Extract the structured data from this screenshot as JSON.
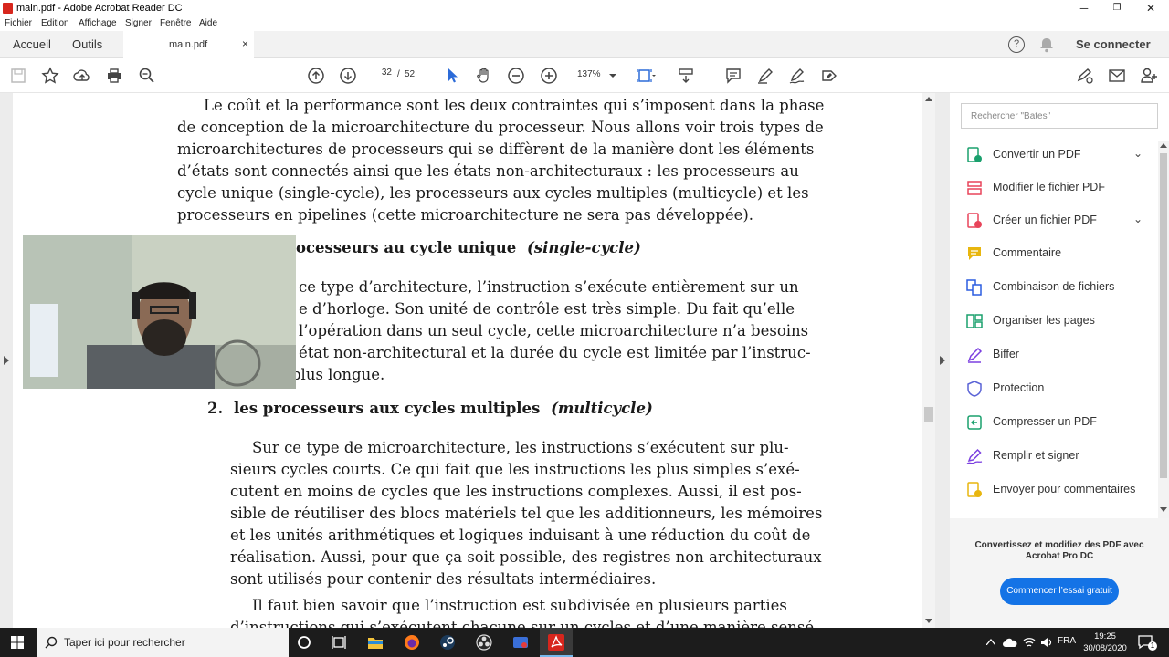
{
  "window": {
    "title": "main.pdf - Adobe Acrobat Reader DC",
    "minimize": "─",
    "maximize": "❐",
    "close": "✕"
  },
  "menu": [
    "Fichier",
    "Edition",
    "Affichage",
    "Signer",
    "Fenêtre",
    "Aide"
  ],
  "tabs": {
    "home": "Accueil",
    "tools": "Outils",
    "document": "main.pdf",
    "close": "×",
    "signin": "Se connecter",
    "help": "?"
  },
  "toolbar": {
    "current_page": "32",
    "page_sep": "/",
    "total_pages": "52",
    "zoom": "137%"
  },
  "document": {
    "intro_lines": [
      "Le coût et la performance sont les deux contraintes qui s’imposent dans la phase",
      "de conception de la microarchitecture du processeur. Nous allons voir trois types de",
      "microarchitectures de processeurs qui se diffèrent de la manière dont les éléments",
      "d’états sont connectés ainsi que les états non-architecturaux : les processeurs au",
      "cycle unique (single-cycle), les processeurs aux cycles multiples (multicycle) et les",
      "processeurs en pipelines (cette microarchitecture ne sera pas développée)."
    ],
    "heading1_visible": "ocesseurs au cycle unique",
    "heading1_italic": "(single-cycle)",
    "item1_lines": [
      "ce type d’architecture, l’instruction s’exécute entièrement sur un",
      "e d’horloge. Son unité de contrôle est très simple. Du fait qu’elle",
      "l’opération dans un seul cycle, cette microarchitecture n’a besoins",
      "état non-architectural et la durée du cycle est limitée par l’instruc-",
      "plus longue."
    ],
    "heading2_number": "2.",
    "heading2": "les processeurs aux cycles multiples",
    "heading2_italic": "(multicycle)",
    "item2_lines": [
      "Sur ce type de microarchitecture, les instructions s’exécutent sur plu-",
      "sieurs cycles courts. Ce qui fait que les instructions les plus simples s’exé-",
      "cutent en moins de cycles que les instructions complexes. Aussi, il est pos-",
      "sible de réutiliser des blocs matériels tel que les additionneurs, les mémoires",
      "et les unités arithmétiques et logiques induisant à une réduction du coût de",
      "réalisation. Aussi, pour que ça soit possible, des registres non architecturaux",
      "sont utilisés pour contenir des résultats intermédiaires."
    ],
    "para3_lines": [
      "Il faut bien savoir que l’instruction est subdivisée en plusieurs parties",
      "d’instructions qui s’exécutent chacune sur un cycles et d’une manière sensé"
    ]
  },
  "panel": {
    "search_placeholder": "Rechercher \"Bates\"",
    "tools": [
      {
        "label": "Convertir un PDF",
        "icon": "export-pdf-icon",
        "color": "#1aa06d",
        "expand": "⌄"
      },
      {
        "label": "Modifier le fichier PDF",
        "icon": "edit-pdf-icon",
        "color": "#e8445a",
        "expand": ""
      },
      {
        "label": "Créer un fichier PDF",
        "icon": "create-pdf-icon",
        "color": "#e8445a",
        "expand": "⌄"
      },
      {
        "label": "Commentaire",
        "icon": "comment-icon",
        "color": "#e8b60f",
        "expand": ""
      },
      {
        "label": "Combinaison de fichiers",
        "icon": "combine-files-icon",
        "color": "#2c5de0",
        "expand": ""
      },
      {
        "label": "Organiser les pages",
        "icon": "organize-pages-icon",
        "color": "#1aa06d",
        "expand": ""
      },
      {
        "label": "Biffer",
        "icon": "redact-icon",
        "color": "#7b3fe0",
        "expand": ""
      },
      {
        "label": "Protection",
        "icon": "protect-shield-icon",
        "color": "#5a63d6",
        "expand": ""
      },
      {
        "label": "Compresser un PDF",
        "icon": "compress-pdf-icon",
        "color": "#1aa06d",
        "expand": ""
      },
      {
        "label": "Remplir et signer",
        "icon": "fill-sign-icon",
        "color": "#7b3fe0",
        "expand": ""
      },
      {
        "label": "Envoyer pour commentaires",
        "icon": "send-comments-icon",
        "color": "#e8b60f",
        "expand": ""
      }
    ],
    "promo_text": "Convertissez et modifiez des PDF avec Acrobat Pro DC",
    "promo_button": "Commencer l’essai gratuit"
  },
  "taskbar": {
    "search_placeholder": "Taper ici pour rechercher",
    "lang": "FRA",
    "time": "19:25",
    "date": "30/08/2020",
    "notif_count": "1"
  }
}
